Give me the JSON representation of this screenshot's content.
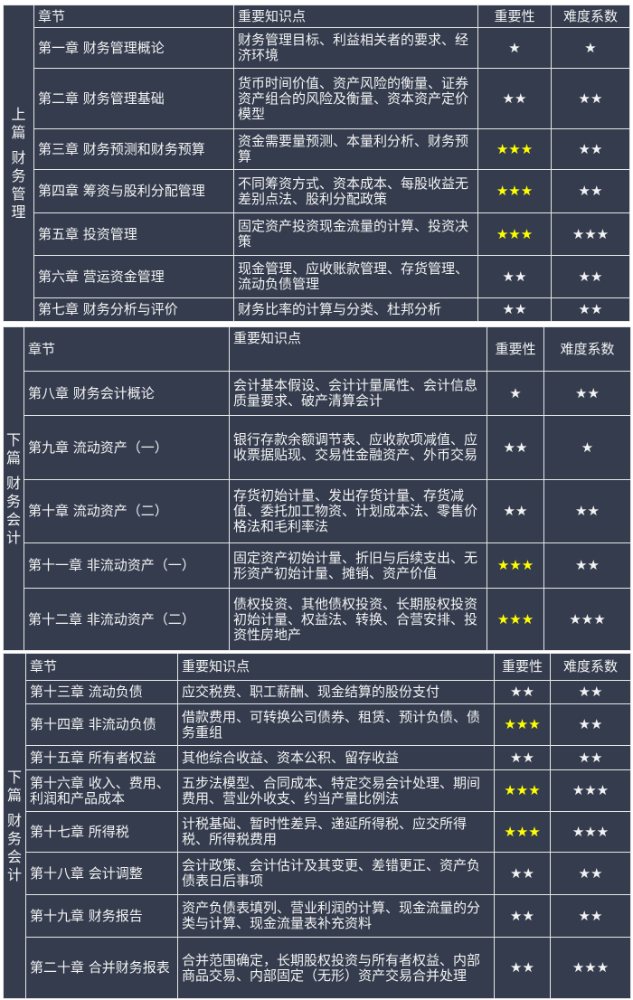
{
  "headers": {
    "chapter": "章节",
    "points": "重要知识点",
    "importance": "重要性",
    "difficulty": "难度系数"
  },
  "tables": [
    {
      "section": "上篇财务管理",
      "section_lines": [
        "上",
        "篇",
        "",
        "财",
        "务",
        "管",
        "理"
      ],
      "rows": [
        {
          "chapter": "第一章 财务管理概论",
          "points": "财务管理目标、利益相关者的要求、经济环境",
          "importance": "★",
          "difficulty": "★"
        },
        {
          "chapter": "第二章 财务管理基础",
          "points": "货币时间价值、资产风险的衡量、证券资产组合的风险及衡量、资本资产定价模型",
          "importance": "★★",
          "difficulty": "★★"
        },
        {
          "chapter": "第三章 财务预测和财务预算",
          "points": "资金需要量预测、本量利分析、财务预算",
          "importance": "★★★",
          "difficulty": "★★"
        },
        {
          "chapter": "第四章 筹资与股利分配管理",
          "points": "不同筹资方式、资本成本、每股收益无差别点法、股利分配政策",
          "importance": "★★★",
          "difficulty": "★★"
        },
        {
          "chapter": "第五章 投资管理",
          "points": "固定资产投资现金流量的计算、投资决策",
          "importance": "★★★",
          "difficulty": "★★★"
        },
        {
          "chapter": "第六章 营运资金管理",
          "points": "现金管理、应收账款管理、存货管理、流动负债管理",
          "importance": "★★",
          "difficulty": "★★"
        },
        {
          "chapter": "第七章 财务分析与评价",
          "points": "财务比率的计算与分类、杜邦分析",
          "importance": "★★",
          "difficulty": "★★"
        }
      ]
    },
    {
      "section": "下篇财务会计",
      "section_lines": [
        "下",
        "篇",
        "",
        "财",
        "务",
        "会",
        "计"
      ],
      "rows": [
        {
          "chapter": "第八章 财务会计概论",
          "points": "会计基本假设、会计计量属性、会计信息质量要求、破产清算会计",
          "importance": "★",
          "difficulty": "★★"
        },
        {
          "chapter": "第九章 流动资产（一）",
          "points": "银行存款余额调节表、应收款项减值、应收票据贴现、交易性金融资产、外币交易",
          "importance": "★★",
          "difficulty": "★"
        },
        {
          "chapter": "第十章 流动资产（二）",
          "points": "存货初始计量、发出存货计量、存货减值、委托加工物资、计划成本法、零售价格法和毛利率法",
          "importance": "★★",
          "difficulty": "★★"
        },
        {
          "chapter": "第十一章 非流动资产（一）",
          "points": "固定资产初始计量、折旧与后续支出、无形资产初始计量、摊销、资产价值",
          "importance": "★★★",
          "difficulty": "★★"
        },
        {
          "chapter": "第十二章 非流动资产（二）",
          "points": "债权投资、其他债权投资、长期股权投资初始计量、权益法、转换、合营安排、投资性房地产",
          "importance": "★★★",
          "difficulty": "★★★"
        }
      ]
    },
    {
      "section": "下篇财务会计",
      "section_lines": [
        "下",
        "篇",
        "",
        "财",
        "务",
        "会",
        "计"
      ],
      "rows": [
        {
          "chapter": "第十三章 流动负债",
          "points": "应交税费、职工薪酬、现金结算的股份支付",
          "importance": "★★",
          "difficulty": "★★"
        },
        {
          "chapter": "第十四章 非流动负债",
          "points": "借款费用、可转换公司债券、租赁、预计负债、债务重组",
          "importance": "★★★",
          "difficulty": "★★"
        },
        {
          "chapter": "第十五章 所有者权益",
          "points": "其他综合收益、资本公积、留存收益",
          "importance": "★★",
          "difficulty": "★★"
        },
        {
          "chapter": "第十六章 收入、费用、利润和产品成本",
          "points": "五步法模型、合同成本、特定交易会计处理、期间费用、营业外收支、约当产量比例法",
          "importance": "★★★",
          "difficulty": "★★★"
        },
        {
          "chapter": "第十七章 所得税",
          "points": "计税基础、暂时性差异、递延所得税、应交所得税、所得税费用",
          "importance": "★★★",
          "difficulty": "★★★"
        },
        {
          "chapter": "第十八章 会计调整",
          "points": "会计政策、会计估计及其变更、差错更正、资产负债表日后事项",
          "importance": "★★",
          "difficulty": "★★"
        },
        {
          "chapter": "第十九章 财务报告",
          "points": "资产负债表填列、营业利润的计算、现金流量的分类与计算、现金流量表补充资料",
          "importance": "★★",
          "difficulty": "★★"
        },
        {
          "chapter": "第二十章 合并财务报表",
          "points": "合并范围确定，长期股权投资与所有者权益、内部商品交易、内部固定（无形）资产交易合并处理",
          "importance": "★★",
          "difficulty": "★★★"
        }
      ]
    }
  ],
  "colors": {
    "background": "#343c4e",
    "border": "#e8e8e8",
    "text": "#f2f2f2",
    "highlight_star": "#ffff00"
  }
}
